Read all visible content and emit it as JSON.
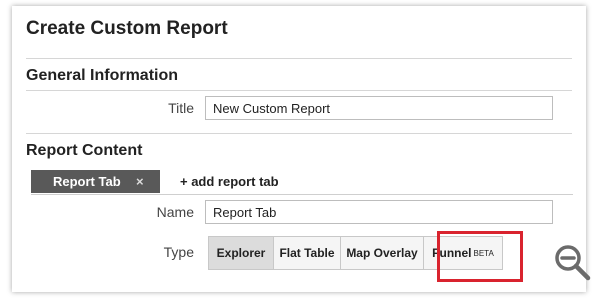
{
  "page": {
    "title": "Create Custom Report"
  },
  "general": {
    "section_title": "General Information",
    "title_label": "Title",
    "title_value": "New Custom Report"
  },
  "content": {
    "section_title": "Report Content",
    "tabs": [
      {
        "label": "Report Tab",
        "close_glyph": "×"
      }
    ],
    "add_tab_label": "+ add report tab",
    "name_label": "Name",
    "name_value": "Report Tab",
    "type_label": "Type",
    "types": [
      {
        "label": "Explorer",
        "selected": true
      },
      {
        "label": "Flat Table",
        "selected": false
      },
      {
        "label": "Map Overlay",
        "selected": false
      },
      {
        "label": "Funnel",
        "badge": "BETA",
        "selected": false,
        "highlighted": true
      }
    ]
  },
  "icons": {
    "zoom": "zoom-out-magnifier-icon"
  },
  "colors": {
    "highlight": "#d9232e",
    "tab_background": "#595959",
    "icon_gray": "#6b6b6b"
  }
}
